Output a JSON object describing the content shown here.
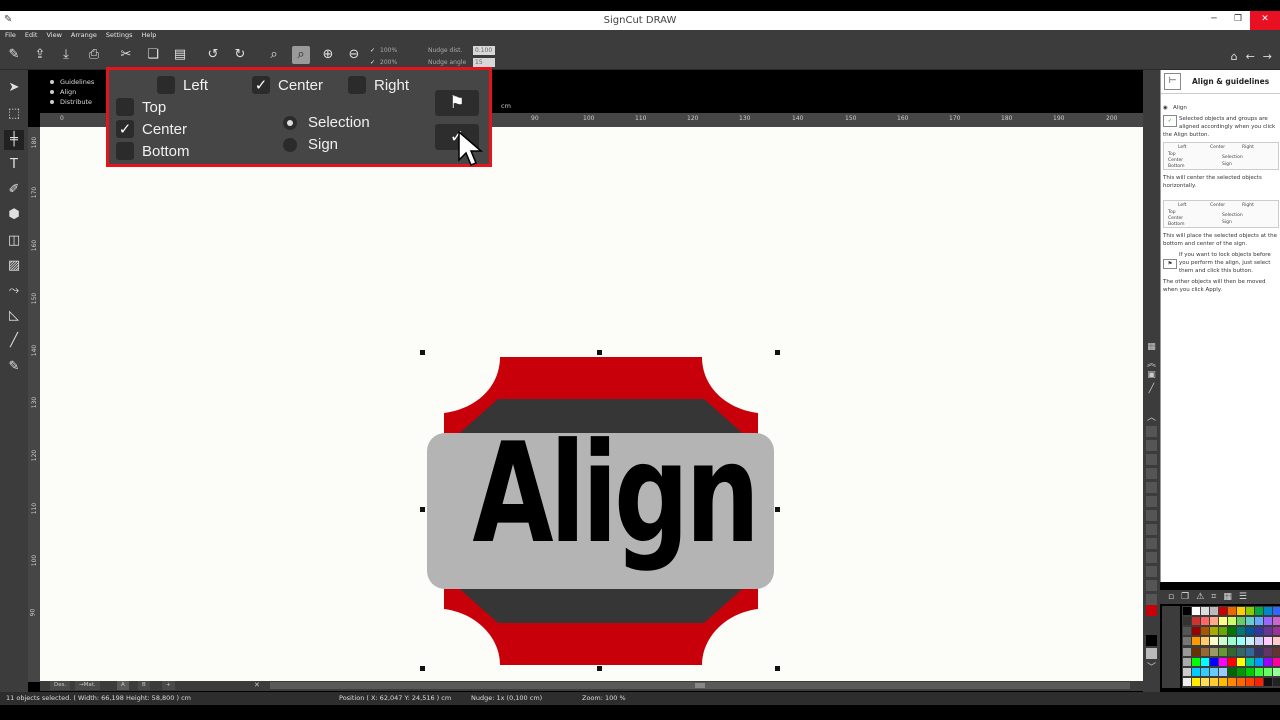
{
  "window": {
    "title": "SignCut DRAW"
  },
  "menu": [
    "File",
    "Edit",
    "View",
    "Arrange",
    "Settings",
    "Help"
  ],
  "toolbar": {
    "zoom_checks": [
      "100%",
      "200%"
    ],
    "nudge_dist_label": "Nudge dist.",
    "nudge_dist_value": "0.100",
    "nudge_angle_label": "Nudge angle",
    "nudge_angle_value": "15"
  },
  "align_mode": {
    "options": [
      "Guidelines",
      "Align",
      "Distribute"
    ],
    "selected": "Align"
  },
  "align_panel": {
    "left": "Left",
    "center_h": "Center",
    "right": "Right",
    "top": "Top",
    "center_v": "Center",
    "bottom": "Bottom",
    "selection": "Selection",
    "sign": "Sign",
    "checked": [
      "Center (horizontal)",
      "Center (vertical)"
    ],
    "radio_selected": "Selection"
  },
  "ruler": {
    "unit": "cm",
    "top_ticks": [
      "0",
      "90",
      "100",
      "110",
      "120",
      "130",
      "140",
      "150",
      "160",
      "170",
      "180",
      "190",
      "200"
    ],
    "left_ticks": [
      "180",
      "170",
      "160",
      "150",
      "140",
      "130",
      "120",
      "110",
      "100",
      "90"
    ]
  },
  "canvas": {
    "design_text": "Align",
    "colors": {
      "outer": "#c8000a",
      "band": "#363636",
      "plate": "#b4b4b4",
      "text": "#000000"
    }
  },
  "help": {
    "title": "Align & guidelines",
    "radio_align": "Align",
    "p1": "Selected objects and groups are aligned accordingly when you click the Align button.",
    "p2": "This will center the selected objects horizontally.",
    "p3": "This will place the selected objects at the bottom and center of the sign.",
    "p4": "If you want to lock objects before you perform the align, just select them and click this button.",
    "p5": "The other objects will then be moved when you click Apply.",
    "mini_labels": {
      "left": "Left",
      "center": "Center",
      "right": "Right",
      "top": "Top",
      "center_v": "Center",
      "bottom": "Bottom",
      "selection": "Selection",
      "sign": "Sign"
    }
  },
  "tabs": [
    "Des.",
    "→Mat.",
    "A",
    "B",
    "+"
  ],
  "status": {
    "selected": "11 objects selected.  ( Width: 66,198  Height: 58,800 ) cm",
    "position": "Position  ( X: 62,047   Y: 24,516 ) cm",
    "nudge": "Nudge: 1x (0,100 cm)",
    "zoom": "Zoom: 100 %"
  }
}
